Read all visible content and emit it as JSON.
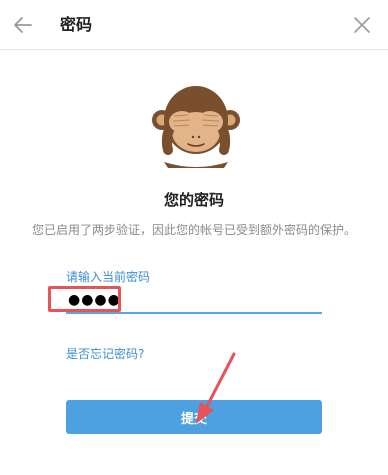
{
  "header": {
    "title": "密码",
    "back_icon": "arrow-left-icon",
    "close_icon": "close-icon"
  },
  "main": {
    "illustration": "see-no-evil-monkey-icon",
    "heading": "您的密码",
    "description": "您已启用了两步验证，因此您的帐号已受到额外密码的保护。",
    "password_label": "请输入当前密码",
    "password_value": "●●●●",
    "forgot_link": "是否忘记密码?",
    "submit_label": "提交"
  },
  "colors": {
    "accent": "#4ea1e0",
    "link": "#3a8fd6",
    "annotation": "#e8535b"
  }
}
